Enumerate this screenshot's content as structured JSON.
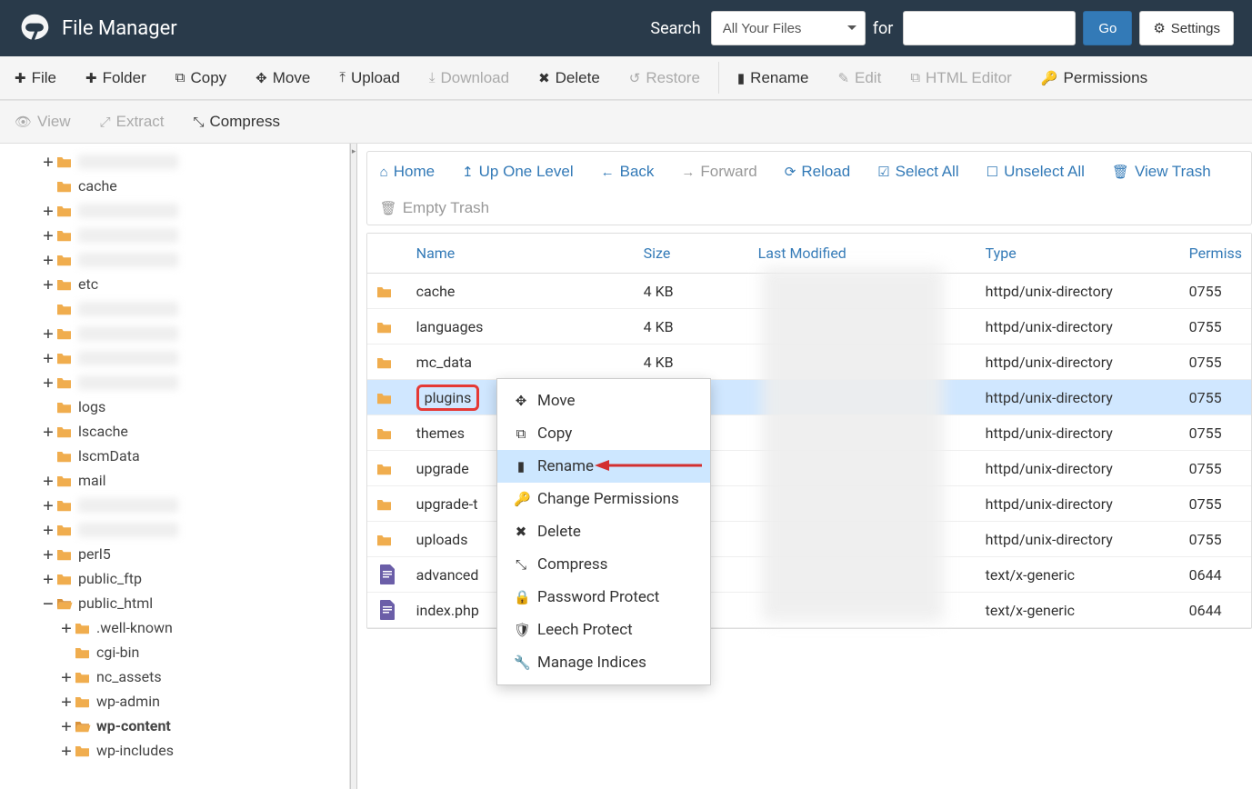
{
  "app_title": "File Manager",
  "header": {
    "search_label": "Search",
    "search_select": "All Your Files",
    "for_label": "for",
    "go_label": "Go",
    "settings_label": "Settings"
  },
  "toolbar": {
    "file": "File",
    "folder": "Folder",
    "copy": "Copy",
    "move": "Move",
    "upload": "Upload",
    "download": "Download",
    "delete": "Delete",
    "restore": "Restore",
    "rename": "Rename",
    "edit": "Edit",
    "html_editor": "HTML Editor",
    "permissions": "Permissions",
    "view": "View",
    "extract": "Extract",
    "compress": "Compress"
  },
  "actions": {
    "home": "Home",
    "up": "Up One Level",
    "back": "Back",
    "forward": "Forward",
    "reload": "Reload",
    "select_all": "Select All",
    "unselect_all": "Unselect All",
    "view_trash": "View Trash",
    "empty_trash": "Empty Trash"
  },
  "columns": {
    "name": "Name",
    "size": "Size",
    "last_modified": "Last Modified",
    "type": "Type",
    "permissions": "Permiss"
  },
  "tree": [
    {
      "depth": 0,
      "toggle": "+",
      "label": "",
      "redacted": true
    },
    {
      "depth": 0,
      "toggle": "",
      "label": "cache"
    },
    {
      "depth": 0,
      "toggle": "+",
      "label": "",
      "redacted": true
    },
    {
      "depth": 0,
      "toggle": "+",
      "label": "",
      "redacted": true
    },
    {
      "depth": 0,
      "toggle": "+",
      "label": "",
      "redacted": true
    },
    {
      "depth": 0,
      "toggle": "+",
      "label": "etc"
    },
    {
      "depth": 0,
      "toggle": "",
      "label": "",
      "redacted": true
    },
    {
      "depth": 0,
      "toggle": "+",
      "label": "",
      "redacted": true
    },
    {
      "depth": 0,
      "toggle": "+",
      "label": "",
      "redacted": true
    },
    {
      "depth": 0,
      "toggle": "+",
      "label": "",
      "redacted": true
    },
    {
      "depth": 0,
      "toggle": "",
      "label": "logs"
    },
    {
      "depth": 0,
      "toggle": "+",
      "label": "lscache"
    },
    {
      "depth": 0,
      "toggle": "",
      "label": "lscmData"
    },
    {
      "depth": 0,
      "toggle": "+",
      "label": "mail"
    },
    {
      "depth": 0,
      "toggle": "+",
      "label": "",
      "redacted": true
    },
    {
      "depth": 0,
      "toggle": "+",
      "label": "",
      "redacted": true
    },
    {
      "depth": 0,
      "toggle": "+",
      "label": "perl5"
    },
    {
      "depth": 0,
      "toggle": "+",
      "label": "public_ftp"
    },
    {
      "depth": 0,
      "toggle": "−",
      "label": "public_html",
      "open": true
    },
    {
      "depth": 1,
      "toggle": "+",
      "label": ".well-known"
    },
    {
      "depth": 1,
      "toggle": "",
      "label": "cgi-bin"
    },
    {
      "depth": 1,
      "toggle": "+",
      "label": "nc_assets"
    },
    {
      "depth": 1,
      "toggle": "+",
      "label": "wp-admin"
    },
    {
      "depth": 1,
      "toggle": "+",
      "label": "wp-content",
      "open": true,
      "bold": true
    },
    {
      "depth": 1,
      "toggle": "+",
      "label": "wp-includes"
    }
  ],
  "rows": [
    {
      "icon": "folder",
      "name": "cache",
      "size": "4 KB",
      "type": "httpd/unix-directory",
      "perm": "0755"
    },
    {
      "icon": "folder",
      "name": "languages",
      "size": "4 KB",
      "type": "httpd/unix-directory",
      "perm": "0755"
    },
    {
      "icon": "folder",
      "name": "mc_data",
      "size": "4 KB",
      "type": "httpd/unix-directory",
      "perm": "0755"
    },
    {
      "icon": "folder",
      "name": "plugins",
      "size": "",
      "type": "httpd/unix-directory",
      "perm": "0755",
      "selected": true,
      "highlight": true
    },
    {
      "icon": "folder",
      "name": "themes",
      "size": "",
      "type": "httpd/unix-directory",
      "perm": "0755"
    },
    {
      "icon": "folder",
      "name": "upgrade",
      "size": "",
      "type": "httpd/unix-directory",
      "perm": "0755"
    },
    {
      "icon": "folder",
      "name": "upgrade-t",
      "size": "",
      "type": "httpd/unix-directory",
      "perm": "0755"
    },
    {
      "icon": "folder",
      "name": "uploads",
      "size": "",
      "type": "httpd/unix-directory",
      "perm": "0755"
    },
    {
      "icon": "file",
      "name": "advanced",
      "size": "",
      "type": "text/x-generic",
      "perm": "0644"
    },
    {
      "icon": "file",
      "name": "index.php",
      "size": "",
      "type": "text/x-generic",
      "perm": "0644"
    }
  ],
  "context_menu": [
    {
      "icon": "move",
      "label": "Move"
    },
    {
      "icon": "copy",
      "label": "Copy"
    },
    {
      "icon": "rename",
      "label": "Rename",
      "hover": true
    },
    {
      "icon": "perm",
      "label": "Change Permissions"
    },
    {
      "icon": "del",
      "label": "Delete"
    },
    {
      "icon": "compress",
      "label": "Compress"
    },
    {
      "icon": "lock",
      "label": "Password Protect"
    },
    {
      "icon": "shield",
      "label": "Leech Protect"
    },
    {
      "icon": "wrench",
      "label": "Manage Indices"
    }
  ]
}
